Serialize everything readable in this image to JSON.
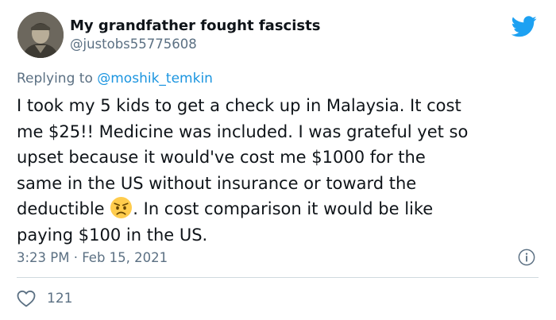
{
  "author": {
    "display_name": "My grandfather fought fascists",
    "handle": "@justobs55775608",
    "avatar_icon": "avatar-photo"
  },
  "reply": {
    "prefix": "Replying to",
    "mention": "@moshik_temkin"
  },
  "tweet": {
    "lines": [
      "I took my 5 kids to get a check up in Malaysia. It cost",
      "me $25!! Medicine was included. I was grateful yet so",
      "upset because it would've cost me $1000 for the",
      "same in the US without insurance or toward the"
    ],
    "line5_before_emoji": "deductible",
    "emoji": "angry-face-emoji",
    "line5_after_emoji": ". In cost comparison it would be like",
    "line6": "paying $100 in the US."
  },
  "meta": {
    "timestamp": "3:23 PM · Feb 15, 2021",
    "info_icon": "info-icon"
  },
  "actions": {
    "like_icon": "heart-icon",
    "like_count": "121"
  },
  "colors": {
    "twitter_blue": "#1da1f2",
    "mention_blue": "#1b95e0",
    "secondary_text": "#5b7083",
    "primary_text": "#0f1419",
    "divider": "#cfd9de"
  }
}
